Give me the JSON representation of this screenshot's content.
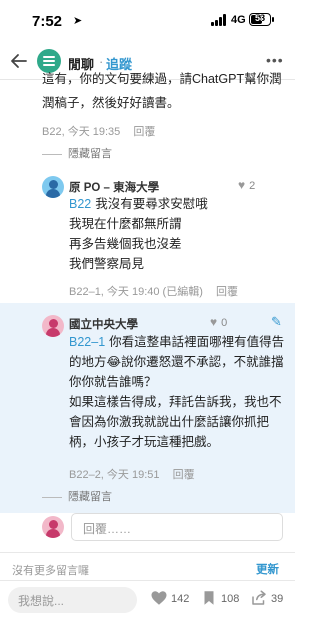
{
  "status_bar": {
    "time": "7:52",
    "network": "4G",
    "battery": "58"
  },
  "header": {
    "board_name": "閒聊",
    "separator": "·",
    "follow_label": "追蹤"
  },
  "previous_comment": {
    "text_line1": "這有，你的文句要練過，請ChatGPT幫你潤",
    "text_line2": "潤稿子，然後好好讀書。",
    "floor": "B22",
    "time": "今天 19:35",
    "reply_label": "回覆",
    "hide_label": "隱藏留言"
  },
  "comments": [
    {
      "author": "原 PO – 東海大學",
      "likes": "2",
      "floor_tag": "B22",
      "lines": [
        "我沒有要尋求安慰哦",
        "我現在什麼都無所謂",
        "再多告幾個我也沒差",
        "我們警察局見"
      ],
      "meta": "B22–1, 今天 19:40 (已編輯)",
      "reply_label": "回覆"
    },
    {
      "author": "國立中央大學",
      "likes": "0",
      "floor_tag": "B22–1",
      "lines": [
        "你看這整串話裡面哪裡有值得告",
        "的地方😂說你遷怒還不承認，不就誰擋",
        "你你就告誰嗎？",
        "如果這樣告得成，拜託告訴我，我也不",
        "會因為你激我就說出什麼話讓你抓把",
        "柄，小孩子才玩這種把戲。"
      ],
      "meta": "B22–2, 今天 19:51",
      "reply_label": "回覆",
      "hide_label": "隱藏留言"
    }
  ],
  "reply_input": {
    "placeholder": "回覆……"
  },
  "footer": {
    "no_more_label": "沒有更多留言囉",
    "refresh_label": "更新"
  },
  "bottom_bar": {
    "input_placeholder": "我想說...",
    "like_count": "142",
    "bookmark_count": "108",
    "share_count": "39"
  },
  "colors": {
    "accent": "#3397cf",
    "highlight_bg": "#eaf3fb"
  }
}
